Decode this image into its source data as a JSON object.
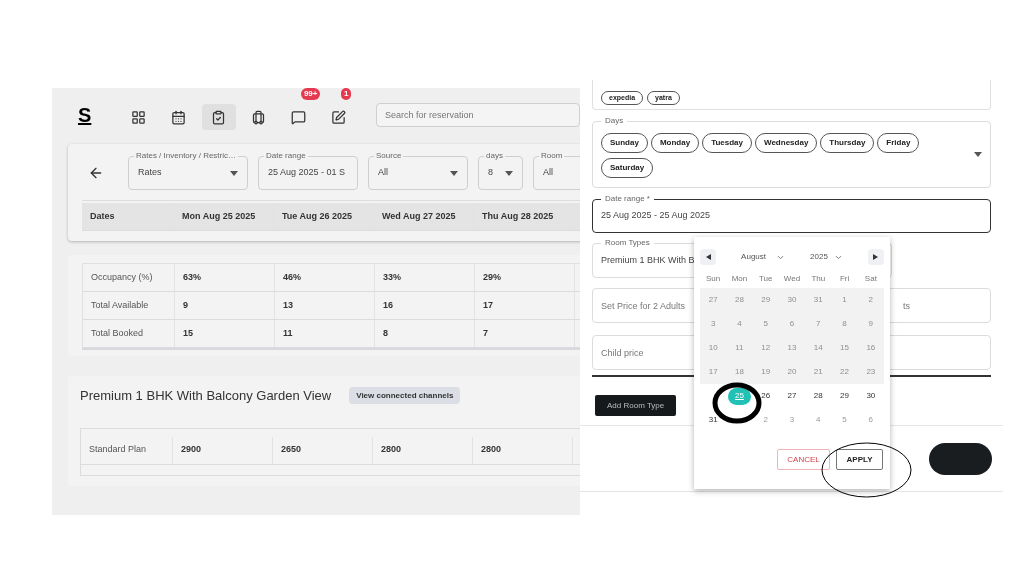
{
  "header": {
    "logo": "S",
    "nav": [
      {
        "selected": false
      },
      {
        "selected": false
      },
      {
        "selected": true
      },
      {
        "selected": false
      },
      {
        "selected": false,
        "badge": "99+"
      },
      {
        "selected": false,
        "badge": "1"
      }
    ],
    "search": {
      "placeholder": "Search for reservation"
    }
  },
  "filters": [
    {
      "label": "Rates / Inventory / Restric…",
      "value": "Rates",
      "dropdown": true
    },
    {
      "label": "Date range",
      "value": "25 Aug 2025 - 01 S",
      "dropdown": false
    },
    {
      "label": "Source",
      "value": "All",
      "dropdown": true
    },
    {
      "label": "days",
      "value": "8",
      "dropdown": true
    },
    {
      "label": "Room",
      "value": "All",
      "dropdown": false
    }
  ],
  "dates_header": [
    "Dates",
    "Mon Aug 25 2025",
    "Tue Aug 26 2025",
    "Wed Aug 27 2025",
    "Thu Aug 28 2025"
  ],
  "stats": [
    [
      "Occupancy (%)",
      "63%",
      "46%",
      "33%",
      "29%"
    ],
    [
      "Total Available",
      "9",
      "13",
      "16",
      "17"
    ],
    [
      "Total Booked",
      "15",
      "11",
      "8",
      "7"
    ]
  ],
  "room": {
    "title": "Premium 1 BHK With Balcony Garden View",
    "button": "View connected channels",
    "plans": [
      [
        "Standard Plan",
        "2900",
        "2650",
        "2800",
        "2800"
      ]
    ]
  },
  "drawer": {
    "channels": [
      "expedia",
      "yatra"
    ],
    "days": {
      "label": "Days",
      "chips": [
        "Sunday",
        "Monday",
        "Tuesday",
        "Wednesday",
        "Thursday",
        "Friday",
        "Saturday"
      ]
    },
    "date_range": {
      "label": "Date range *",
      "value": "25 Aug 2025 - 25 Aug 2025"
    },
    "room_types": {
      "label": "Room Types",
      "value": "Premium 1 BHK With B"
    },
    "price_fields": [
      {
        "placeholder": "Set Price for 2 Adults"
      },
      {
        "placeholder": "ts"
      }
    ],
    "child_price": {
      "placeholder": "Child price"
    },
    "add_button": "Add Room Type"
  },
  "calendar": {
    "month": "August",
    "year": "2025",
    "weekdays": [
      "Sun",
      "Mon",
      "Tue",
      "Wed",
      "Thu",
      "Fri",
      "Sat"
    ],
    "weeks": [
      [
        {
          "day": "27",
          "kind": "past"
        },
        {
          "day": "28",
          "kind": "past"
        },
        {
          "day": "29",
          "kind": "past"
        },
        {
          "day": "30",
          "kind": "past"
        },
        {
          "day": "31",
          "kind": "past"
        },
        {
          "day": "1",
          "kind": "past"
        },
        {
          "day": "2",
          "kind": "past"
        }
      ],
      [
        {
          "day": "3",
          "kind": "past"
        },
        {
          "day": "4",
          "kind": "past"
        },
        {
          "day": "5",
          "kind": "past"
        },
        {
          "day": "6",
          "kind": "past"
        },
        {
          "day": "7",
          "kind": "past"
        },
        {
          "day": "8",
          "kind": "past"
        },
        {
          "day": "9",
          "kind": "past"
        }
      ],
      [
        {
          "day": "10",
          "kind": "past"
        },
        {
          "day": "11",
          "kind": "past"
        },
        {
          "day": "12",
          "kind": "past"
        },
        {
          "day": "13",
          "kind": "past"
        },
        {
          "day": "14",
          "kind": "past"
        },
        {
          "day": "15",
          "kind": "past"
        },
        {
          "day": "16",
          "kind": "past"
        }
      ],
      [
        {
          "day": "17",
          "kind": "past"
        },
        {
          "day": "18",
          "kind": "past"
        },
        {
          "day": "19",
          "kind": "past"
        },
        {
          "day": "20",
          "kind": "past"
        },
        {
          "day": "21",
          "kind": "past"
        },
        {
          "day": "22",
          "kind": "past"
        },
        {
          "day": "23",
          "kind": "past"
        }
      ],
      [
        {
          "kind": "hidden"
        },
        {
          "day": "25",
          "kind": "day",
          "selected": true
        },
        {
          "day": "26",
          "kind": "day",
          "selected": false
        },
        {
          "day": "27",
          "kind": "day",
          "selected": false
        },
        {
          "day": "28",
          "kind": "day",
          "selected": false
        },
        {
          "day": "29",
          "kind": "day",
          "selected": false
        },
        {
          "day": "30",
          "kind": "day",
          "selected": false
        }
      ],
      [
        {
          "day": "31",
          "kind": "day",
          "selected": false
        },
        {
          "kind": "hidden"
        },
        {
          "day": "2",
          "kind": "next"
        },
        {
          "day": "3",
          "kind": "next"
        },
        {
          "day": "4",
          "kind": "next"
        },
        {
          "day": "5",
          "kind": "next"
        },
        {
          "day": "6",
          "kind": "next"
        }
      ]
    ],
    "cancel": "CANCEL",
    "apply": "APPLY"
  }
}
